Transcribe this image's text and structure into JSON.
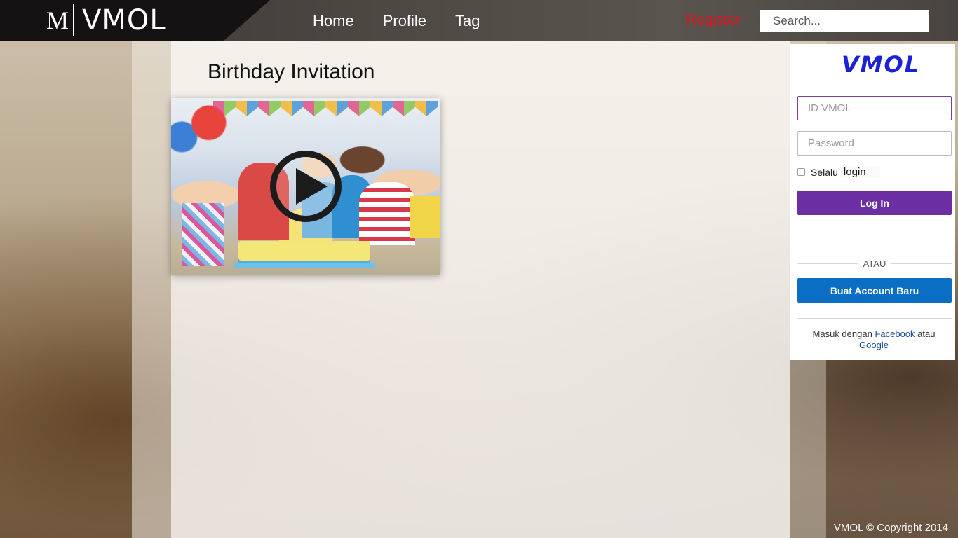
{
  "header": {
    "logo_mark": "M",
    "logo_text": "VMOL",
    "nav": [
      "Home",
      "Profile",
      "Tag"
    ],
    "register": "Register",
    "search_placeholder": "Search..."
  },
  "main": {
    "title": "Birthday Invitation",
    "video": {
      "thumbnail": "birthday-party-kids-thumbnail",
      "play_icon": "play-icon"
    }
  },
  "login": {
    "brand": "VMOL",
    "id_placeholder": "ID VMOL",
    "password_placeholder": "Password",
    "remember_label": "Selalu",
    "remember_suffix": "login",
    "login_button": "Log In",
    "divider": "ATAU",
    "create_button": "Buat Account Baru",
    "social_prefix": "Masuk dengan",
    "facebook": "Facebook",
    "social_join": "atau",
    "google": "Google"
  },
  "footer": {
    "copyright": "VMOL © Copyright 2014"
  },
  "colors": {
    "register": "#e8101e",
    "login_button": "#6b2fa3",
    "create_button": "#0a6ec4",
    "brand": "#1a22d6"
  }
}
